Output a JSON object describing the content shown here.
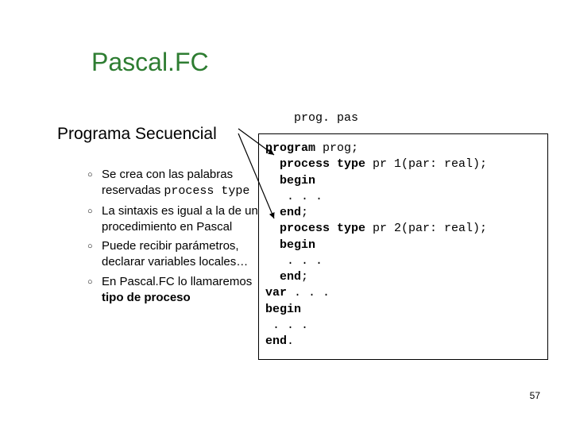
{
  "title": "Pascal.FC",
  "subtitle": "Programa Secuencial",
  "filename": "prog. pas",
  "bullets": [
    {
      "text_before": "Se crea con las palabras reservadas ",
      "code": "process type",
      "text_after": ""
    },
    {
      "text_before": "La sintaxis es igual a la de un procedimiento en Pascal",
      "code": "",
      "text_after": ""
    },
    {
      "text_before": "Puede recibir parámetros, declarar variables locales…",
      "code": "",
      "text_after": ""
    },
    {
      "text_before": "En Pascal.FC lo llamaremos ",
      "code": "",
      "text_after": "",
      "bold_tail": "tipo de proceso"
    }
  ],
  "code": {
    "l1a": "program",
    "l1b": " prog;",
    "l2a": "  process type",
    "l2b": " pr 1(par: real);",
    "l3a": "  begin",
    "l4": "   . . .",
    "l5a": "  end",
    "l5b": ";",
    "l6a": "  process type",
    "l6b": " pr 2(par: real);",
    "l7a": "  begin",
    "l8": "   . . .",
    "l9a": "  end",
    "l9b": ";",
    "l10a": "var",
    "l10b": " . . .",
    "l11a": "begin",
    "l12": " . . .",
    "l13a": "end",
    "l13b": "."
  },
  "pagenum": "57"
}
